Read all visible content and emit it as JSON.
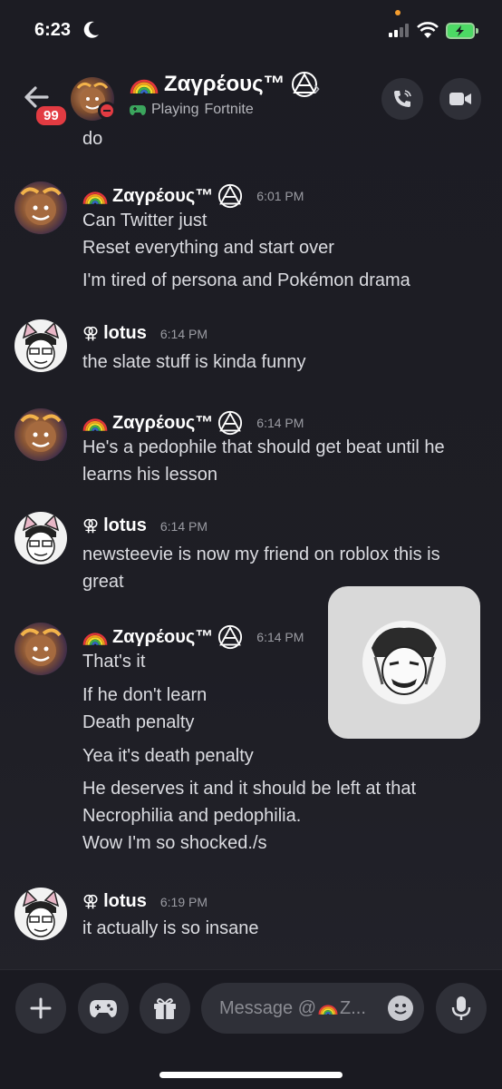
{
  "status_bar": {
    "time": "6:23"
  },
  "header": {
    "unread_badge": "99",
    "title": "Ζαγρέους™",
    "activity_prefix": "Playing",
    "activity_game": "Fortnite"
  },
  "messages": {
    "partial_line": "do",
    "groups": [
      {
        "author": "Ζαγρέους™",
        "time": "6:01 PM",
        "lines": [
          "Can Twitter just",
          "Reset everything and start over",
          "I'm tired of persona and Pokémon drama"
        ]
      },
      {
        "author": "lotus",
        "time": "6:14 PM",
        "lines": [
          "the slate stuff is kinda funny"
        ]
      },
      {
        "author": "Ζαγρέους™",
        "time": "6:14 PM",
        "lines": [
          "He's a pedophile that should get beat until he",
          "learns his lesson"
        ]
      },
      {
        "author": "lotus",
        "time": "6:14 PM",
        "lines": [
          "newsteevie is now my friend on roblox this is",
          "great"
        ]
      },
      {
        "author": "Ζαγρέους™",
        "time": "6:14 PM",
        "lines": [
          "That's it",
          "If he don't learn",
          "Death penalty",
          "Yea it's death penalty",
          "He deserves it and it should be left at that",
          "Necrophilia and pedophilia.",
          "Wow I'm so shocked./s"
        ]
      },
      {
        "author": "lotus",
        "time": "6:19 PM",
        "lines": [
          "it actually is so insane"
        ]
      }
    ]
  },
  "composer": {
    "placeholder": "Message @",
    "placeholder_suffix": "Ζ..."
  },
  "icons": {
    "back": "back-arrow-icon",
    "call": "phone-icon",
    "video": "video-camera-icon",
    "add": "plus-icon",
    "games": "gamepad-icon",
    "gift": "gift-icon",
    "emoji": "emoji-icon",
    "mic": "microphone-icon"
  },
  "colors": {
    "badge": "#e23b42",
    "playing_icon": "#3ba55d",
    "background": "#1c1c23"
  }
}
